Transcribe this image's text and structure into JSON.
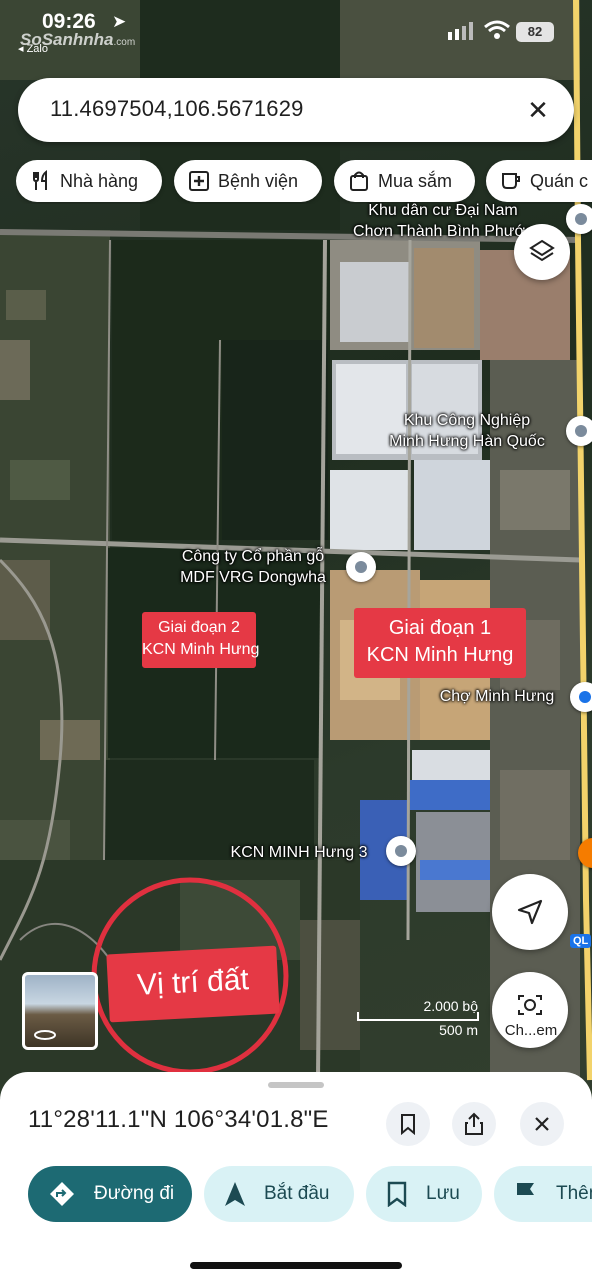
{
  "status_bar": {
    "time": "09:26",
    "back_app": "◂ Zalo",
    "battery": "82"
  },
  "watermark": {
    "brand": "SoSanhnha",
    "suffix": ".com"
  },
  "search": {
    "query": "11.4697504,106.5671629",
    "close_icon": "close-icon"
  },
  "chips": [
    {
      "label": "Nhà hàng",
      "icon": "restaurant-icon"
    },
    {
      "label": "Bệnh viện",
      "icon": "hospital-icon"
    },
    {
      "label": "Mua sắm",
      "icon": "shopping-bag-icon"
    },
    {
      "label": "Quán c",
      "icon": "coffee-icon"
    }
  ],
  "map": {
    "places": {
      "khu_dan_cu": "Khu dân cư Đại Nam\nChơn Thành Bình Phước",
      "kcn_han_quoc": "Khu Công Nghiệp\nMinh Hưng Hàn Quốc",
      "mdf": "Công ty Cổ phần gỗ\nMDF VRG Dongwha",
      "cho": "Chợ Minh Hưng",
      "kcn3": "KCN MINH Hưng 3"
    },
    "annotations": {
      "phase2": "Giai đoạn 2\nKCN Minh Hưng",
      "phase1": "Giai đoạn 1\nKCN Minh Hưng",
      "site": "Vị trí đất"
    },
    "route_badge": "QL",
    "scale": {
      "imperial": "2.000 bộ",
      "metric": "500 m"
    },
    "lens_label": "Ch...em",
    "colors": {
      "annotation_red": "#e53945",
      "circle_red": "#e0303f",
      "route_yellow": "#f2d36b"
    }
  },
  "sheet": {
    "coords": "11°28'11.1\"N 106°34'01.8\"E",
    "actions": [
      {
        "label": "Đường đi",
        "icon": "directions-icon"
      },
      {
        "label": "Bắt đầu",
        "icon": "navigation-arrow-icon"
      },
      {
        "label": "Lưu",
        "icon": "bookmark-icon"
      },
      {
        "label": "Thêm",
        "icon": "flag-icon"
      }
    ]
  }
}
